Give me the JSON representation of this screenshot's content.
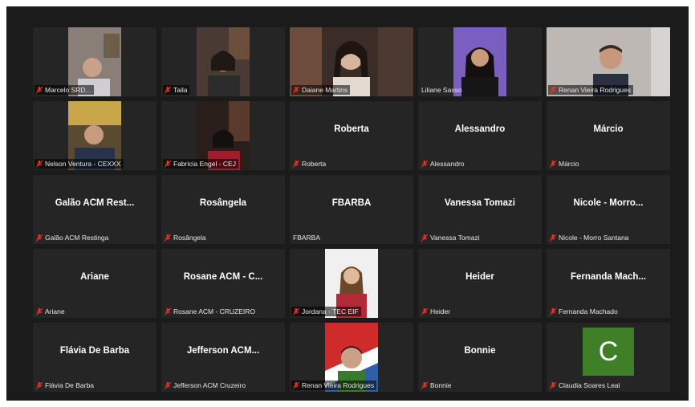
{
  "participants": [
    {
      "label": "Marcelo SRD...",
      "display": "",
      "muted": true
    },
    {
      "label": "Taila",
      "display": "",
      "muted": true
    },
    {
      "label": "Daiane Martins",
      "display": "",
      "muted": true
    },
    {
      "label": "Liliane Sasso",
      "display": "",
      "muted": false
    },
    {
      "label": "Renan Vieira Rodrigues",
      "display": "",
      "muted": true
    },
    {
      "label": "Nelson Ventura - CEXXX",
      "display": "",
      "muted": true
    },
    {
      "label": "Fabricia Engel - CEJ",
      "display": "",
      "muted": true
    },
    {
      "label": "Roberta",
      "display": "Roberta",
      "muted": true
    },
    {
      "label": "Alessandro",
      "display": "Alessandro",
      "muted": true
    },
    {
      "label": "Márcio",
      "display": "Márcio",
      "muted": true
    },
    {
      "label": "Galão ACM Restinga",
      "display": "Galão ACM Rest...",
      "muted": true
    },
    {
      "label": "Rosângela",
      "display": "Rosângela",
      "muted": true
    },
    {
      "label": "FBARBA",
      "display": "FBARBA",
      "muted": false
    },
    {
      "label": "Vanessa Tomazi",
      "display": "Vanessa Tomazi",
      "muted": true
    },
    {
      "label": "Nicole - Morro Santana",
      "display": "Nicole - Morro...",
      "muted": true
    },
    {
      "label": "Ariane",
      "display": "Ariane",
      "muted": true
    },
    {
      "label": "Rosane ACM - CRUZEIRO",
      "display": "Rosane ACM - C...",
      "muted": true
    },
    {
      "label": "Jordana - TEC EIF",
      "display": "",
      "muted": true
    },
    {
      "label": "Heider",
      "display": "Heider",
      "muted": true
    },
    {
      "label": "Fernanda Machado",
      "display": "Fernanda Mach...",
      "muted": true
    },
    {
      "label": "Flávia De Barba",
      "display": "Flávia De Barba",
      "muted": true
    },
    {
      "label": "Jefferson ACM Cruzeiro",
      "display": "Jefferson ACM...",
      "muted": true
    },
    {
      "label": "Renan Vieira Rodrigues",
      "display": "",
      "muted": true
    },
    {
      "label": "Bonnie",
      "display": "Bonnie",
      "muted": true
    },
    {
      "label": "Claudia Soares Leal",
      "display": "",
      "muted": true,
      "avatar_letter": "C",
      "avatar_color": "#3e7f27"
    }
  ],
  "colors": {
    "mute_icon": "#e0352b",
    "tile_bg": "#252525"
  }
}
